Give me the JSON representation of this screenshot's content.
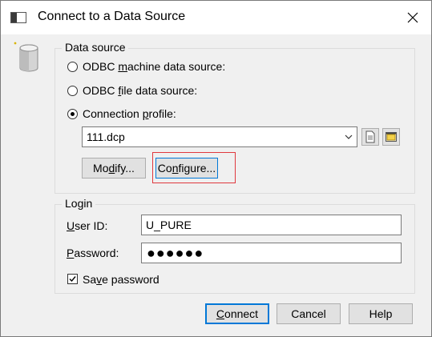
{
  "window": {
    "title": "Connect to a Data Source"
  },
  "data_source": {
    "legend": "Data source",
    "options": [
      {
        "pre": "ODBC ",
        "key": "m",
        "post": "achine data source:",
        "selected": false
      },
      {
        "pre": "ODBC ",
        "key": "f",
        "post": "ile data source:",
        "selected": false
      },
      {
        "pre": "Connection ",
        "key": "p",
        "post": "rofile:",
        "selected": true
      }
    ],
    "profile_value": "111.dcp",
    "modify_pre": "Mo",
    "modify_key": "d",
    "modify_post": "ify...",
    "configure_pre": "Co",
    "configure_key": "n",
    "configure_post": "figure..."
  },
  "login": {
    "legend": "Login",
    "userid_key": "U",
    "userid_post": "ser ID:",
    "userid_value": "U_PURE",
    "password_key": "P",
    "password_post": "assword:",
    "password_value": "●●●●●●",
    "save_pre": "Sa",
    "save_key": "v",
    "save_post": "e password",
    "save_checked": true
  },
  "buttons": {
    "connect_key": "C",
    "connect_post": "onnect",
    "cancel": "Cancel",
    "help": "Help"
  }
}
